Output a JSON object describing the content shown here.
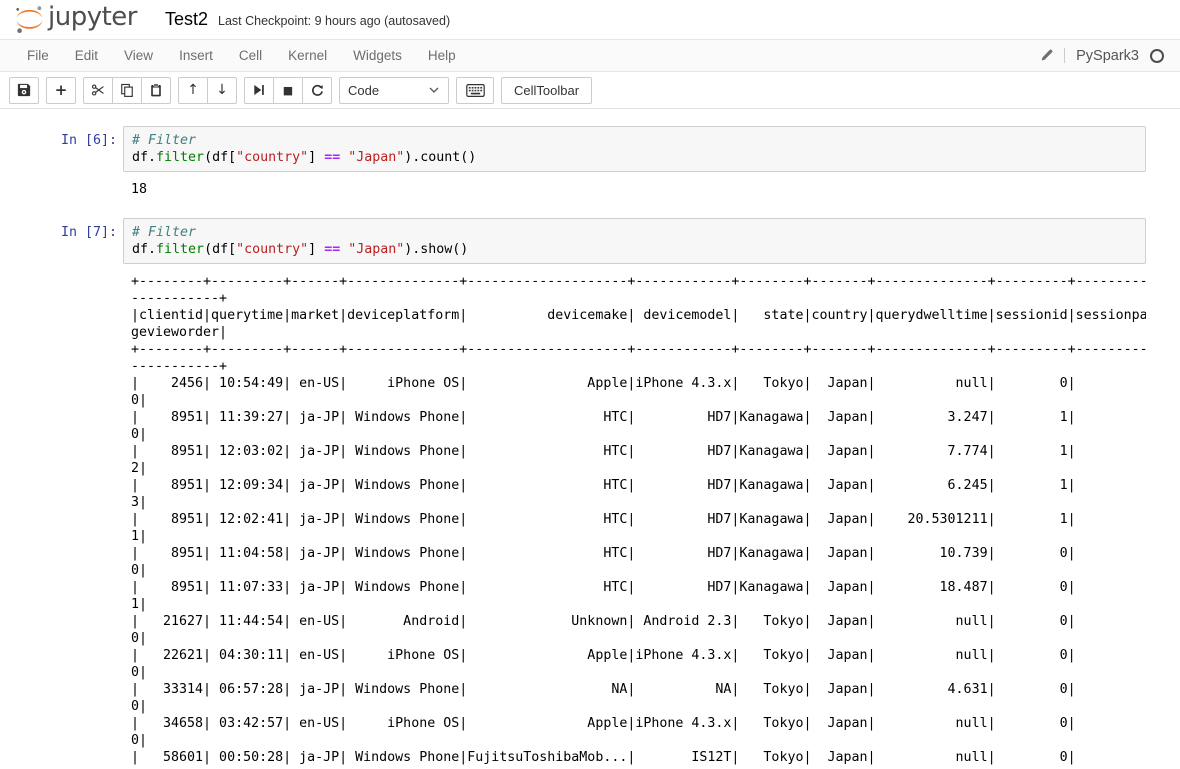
{
  "header": {
    "logo_text": "jupyter",
    "title": "Test2",
    "checkpoint": "Last Checkpoint: 9 hours ago (autosaved)"
  },
  "menubar": {
    "items": [
      "File",
      "Edit",
      "View",
      "Insert",
      "Cell",
      "Kernel",
      "Widgets",
      "Help"
    ],
    "edit_mode_icon": "pencil-icon",
    "kernel_name": "PySpark3",
    "kernel_status": "idle"
  },
  "toolbar": {
    "icons": [
      "save",
      "add-cell-below",
      "cut",
      "copy",
      "paste",
      "move-up",
      "move-down",
      "run",
      "interrupt",
      "restart",
      "keyboard"
    ],
    "cell_type": "Code",
    "celltoolbar_label": "CellToolbar"
  },
  "colors": {
    "brand_orange": "#f37726",
    "prompt_blue": "#303f9f",
    "comment": "#408080",
    "string": "#ba2121",
    "operator": "#aa22ff",
    "builtin": "#008000"
  },
  "cells": [
    {
      "prompt": "In [6]:",
      "code": [
        [
          {
            "t": "# Filter",
            "c": "comment"
          }
        ],
        [
          {
            "t": "df.",
            "c": "plain"
          },
          {
            "t": "filter",
            "c": "builtin"
          },
          {
            "t": "(df[",
            "c": "plain"
          },
          {
            "t": "\"country\"",
            "c": "string"
          },
          {
            "t": "] ",
            "c": "plain"
          },
          {
            "t": "==",
            "c": "operator"
          },
          {
            "t": " ",
            "c": "plain"
          },
          {
            "t": "\"Japan\"",
            "c": "string"
          },
          {
            "t": ").count()",
            "c": "plain"
          }
        ]
      ],
      "output": "18"
    },
    {
      "prompt": "In [7]:",
      "code": [
        [
          {
            "t": "# Filter",
            "c": "comment"
          }
        ],
        [
          {
            "t": "df.",
            "c": "plain"
          },
          {
            "t": "filter",
            "c": "builtin"
          },
          {
            "t": "(df[",
            "c": "plain"
          },
          {
            "t": "\"country\"",
            "c": "string"
          },
          {
            "t": "] ",
            "c": "plain"
          },
          {
            "t": "==",
            "c": "operator"
          },
          {
            "t": " ",
            "c": "plain"
          },
          {
            "t": "\"Japan\"",
            "c": "string"
          },
          {
            "t": ").show()",
            "c": "plain"
          }
        ]
      ],
      "output": "+--------+---------+------+--------------+--------------------+------------+--------+-------+--------------+---------+---------\n-----------+\n|clientid|querytime|market|deviceplatform|          devicemake| devicemodel|   state|country|querydwelltime|sessionid|sessionpa\ngevieworder|\n+--------+---------+------+--------------+--------------------+------------+--------+-------+--------------+---------+---------\n-----------+\n|    2456| 10:54:49| en-US|     iPhone OS|               Apple|iPhone 4.3.x|   Tokyo|  Japan|          null|        0|\n0|\n|    8951| 11:39:27| ja-JP| Windows Phone|                 HTC|         HD7|Kanagawa|  Japan|         3.247|        1|\n0|\n|    8951| 12:03:02| ja-JP| Windows Phone|                 HTC|         HD7|Kanagawa|  Japan|         7.774|        1|\n2|\n|    8951| 12:09:34| ja-JP| Windows Phone|                 HTC|         HD7|Kanagawa|  Japan|         6.245|        1|\n3|\n|    8951| 12:02:41| ja-JP| Windows Phone|                 HTC|         HD7|Kanagawa|  Japan|    20.5301211|        1|\n1|\n|    8951| 11:04:58| ja-JP| Windows Phone|                 HTC|         HD7|Kanagawa|  Japan|        10.739|        0|\n0|\n|    8951| 11:07:33| ja-JP| Windows Phone|                 HTC|         HD7|Kanagawa|  Japan|        18.487|        0|\n1|\n|   21627| 11:44:54| en-US|       Android|             Unknown| Android 2.3|   Tokyo|  Japan|          null|        0|\n0|\n|   22621| 04:30:11| en-US|     iPhone OS|               Apple|iPhone 4.3.x|   Tokyo|  Japan|          null|        0|\n0|\n|   33314| 06:57:28| ja-JP| Windows Phone|                  NA|          NA|   Tokyo|  Japan|         4.631|        0|\n0|\n|   34658| 03:42:57| en-US|     iPhone OS|               Apple|iPhone 4.3.x|   Tokyo|  Japan|          null|        0|\n0|\n|   58601| 00:50:28| ja-JP| Windows Phone|FujitsuToshibaMob...|       IS12T|   Tokyo|  Japan|          null|        0|"
    }
  ]
}
